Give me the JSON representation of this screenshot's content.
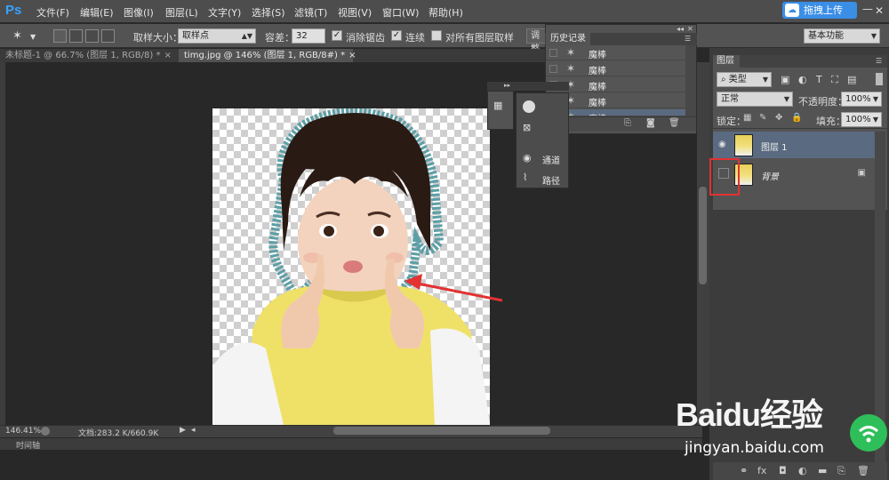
{
  "app": {
    "logo": "Ps"
  },
  "menu": [
    "文件(F)",
    "编辑(E)",
    "图像(I)",
    "图层(L)",
    "文字(Y)",
    "选择(S)",
    "滤镜(T)",
    "视图(V)",
    "窗口(W)",
    "帮助(H)"
  ],
  "upload": {
    "label": "拖拽上传",
    "icon": "cloud-icon"
  },
  "window_controls": [
    "—",
    "▭",
    "✕"
  ],
  "options": {
    "sample_size_label": "取样大小：",
    "sample_size_value": "取样点",
    "tolerance_label": "容差：",
    "tolerance_value": "32",
    "antialias_label": "消除锯齿",
    "contiguous_label": "连续",
    "all_layers_label": "对所有图层取样",
    "refine_label": "调整",
    "workspace": "基本功能"
  },
  "tabs": [
    {
      "label": "未标题-1 @ 66.7% (图层 1, RGB/8) *"
    },
    {
      "label": "timg.jpg @ 146% (图层 1, RGB/8#) *"
    }
  ],
  "history": {
    "title": "历史记录",
    "rows": [
      "魔棒",
      "魔棒",
      "魔棒",
      "魔棒",
      "魔棒"
    ]
  },
  "mini_panel": {
    "channels": "通道",
    "paths": "路径"
  },
  "layers": {
    "title": "图层",
    "filter": "类型",
    "blend_mode": "正常",
    "opacity_label": "不透明度：",
    "opacity_value": "100%",
    "lock_label": "锁定：",
    "fill_label": "填充：",
    "fill_value": "100%",
    "items": [
      {
        "name": "图层 1",
        "selected": true
      },
      {
        "name": "背景",
        "selected": false
      }
    ]
  },
  "status": {
    "zoom": "146.41%",
    "doc_info": "文档:283.2 K/660.9K"
  },
  "timeline": {
    "label": "时间轴"
  },
  "watermark": {
    "brand": "Baidu经验",
    "url": "jingyan.baidu.com"
  },
  "colors": {
    "accent": "#3a8ee6",
    "annotation": "#e23232",
    "selected_layer": "#5a6a80"
  }
}
